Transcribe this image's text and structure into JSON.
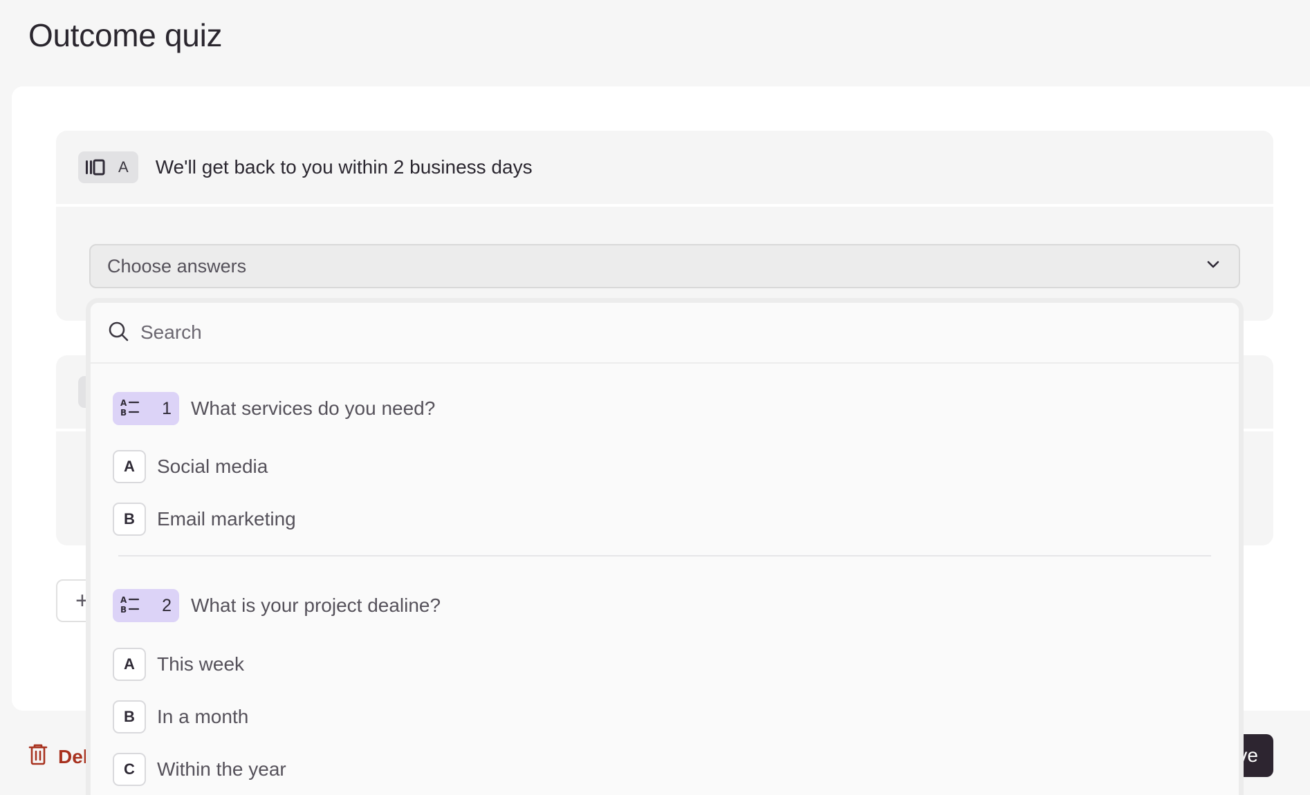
{
  "page": {
    "title": "Outcome quiz"
  },
  "outcomes": [
    {
      "letter": "A",
      "title": "We'll get back to you within 2 business days"
    },
    {
      "letter": "",
      "title": ""
    }
  ],
  "select": {
    "label": "Choose answers"
  },
  "dropdown": {
    "search_placeholder": "Search",
    "questions": [
      {
        "number": "1",
        "text": "What services do you need?",
        "options": [
          {
            "key": "A",
            "label": "Social media"
          },
          {
            "key": "B",
            "label": "Email marketing"
          }
        ]
      },
      {
        "number": "2",
        "text": "What is your project dealine?",
        "options": [
          {
            "key": "A",
            "label": "This week"
          },
          {
            "key": "B",
            "label": "In a month"
          },
          {
            "key": "C",
            "label": "Within the year"
          }
        ]
      }
    ]
  },
  "footer": {
    "delete_label": "Del",
    "save_label": "ve"
  },
  "colors": {
    "accent_purple": "#dcd3f7",
    "danger": "#a8321f",
    "primary_dark": "#2d2530"
  },
  "icons": {
    "outcome": "outcome-ending-icon",
    "question": "multiple-choice-icon",
    "search": "search-icon",
    "chevron": "chevron-down-icon",
    "trash": "trash-icon"
  }
}
